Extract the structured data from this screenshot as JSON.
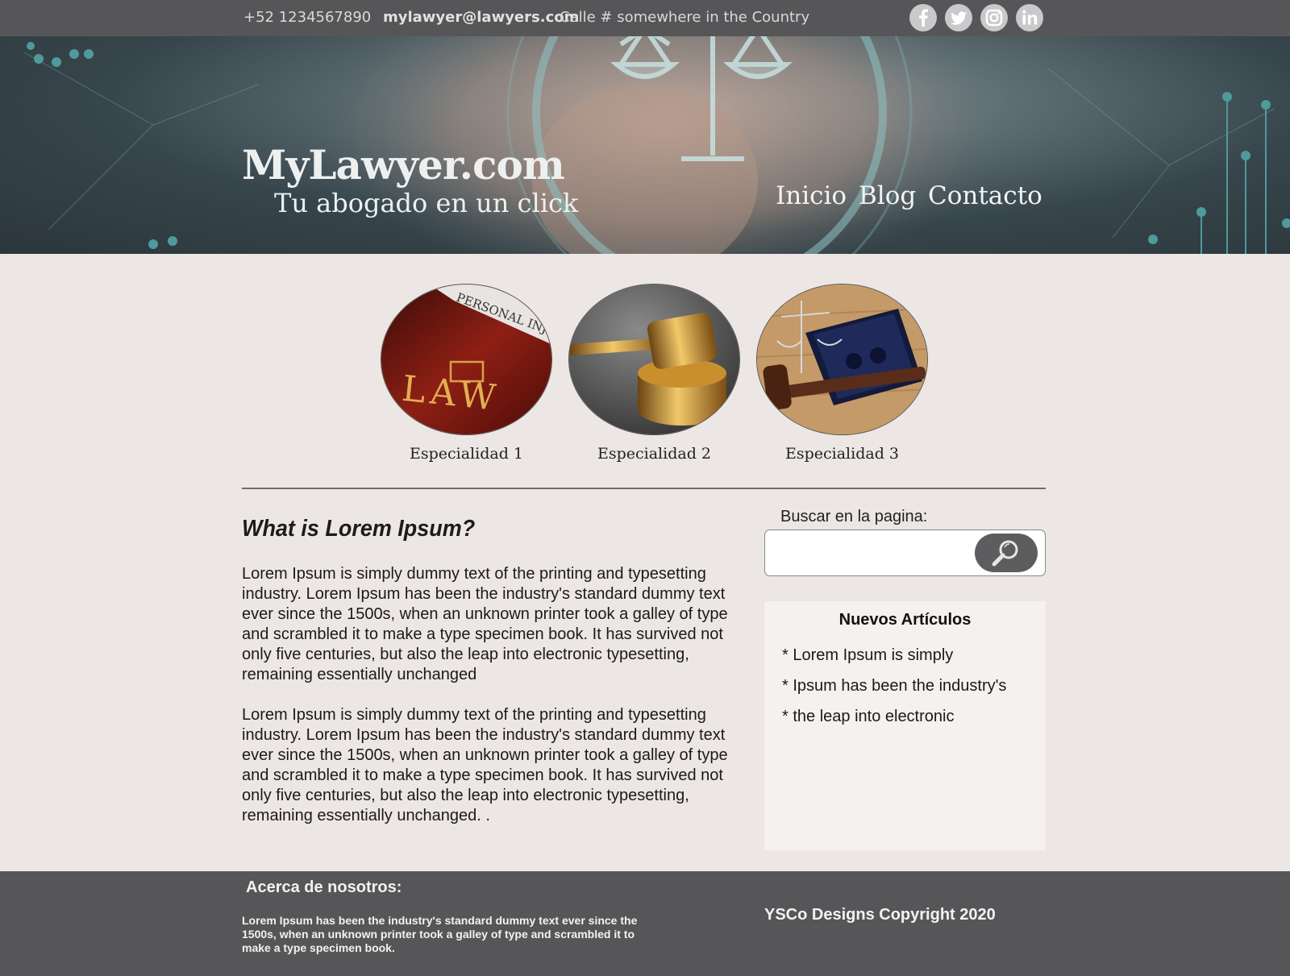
{
  "topbar": {
    "phone": "+52 1234567890",
    "email": "mylawyer@lawyers.com",
    "address": "Calle # somewhere in the Country",
    "social": [
      {
        "icon": "facebook-icon"
      },
      {
        "icon": "twitter-icon"
      },
      {
        "icon": "instagram-icon"
      },
      {
        "icon": "linkedin-icon"
      }
    ]
  },
  "hero": {
    "brand": "MyLawyer.com",
    "tagline": "Tu abogado en un click",
    "nav": [
      "Inicio",
      "Blog",
      "Contacto"
    ]
  },
  "specialties": [
    {
      "label": "Especialidad 1",
      "image": "law-book-image"
    },
    {
      "label": "Especialidad 2",
      "image": "gavel-image"
    },
    {
      "label": "Especialidad 3",
      "image": "scales-and-gavel-image"
    }
  ],
  "article": {
    "title": "What is Lorem Ipsum?",
    "paragraphs": [
      "Lorem Ipsum is simply dummy text of the printing and typesetting industry. Lorem Ipsum has been the industry's standard dummy text ever since the 1500s, when an unknown printer took a galley of type and scrambled it to make a type specimen book. It has survived not only five centuries, but also the leap into electronic typesetting, remaining essentially unchanged",
      "Lorem Ipsum is simply dummy text of the printing and typesetting industry. Lorem Ipsum has been the industry's standard dummy text ever since the 1500s, when an unknown printer took a galley of type and scrambled it to make a type specimen book. It has survived not only five centuries, but also the leap into electronic typesetting, remaining essentially unchanged. ."
    ]
  },
  "search": {
    "label": "Buscar en la pagina:",
    "value": "",
    "icon": "search-icon"
  },
  "news": {
    "title": "Nuevos Artículos",
    "items": [
      "* Lorem Ipsum is simply",
      "*  Ipsum has been the industry's",
      "*  the leap into electronic"
    ]
  },
  "footer": {
    "title": "Acerca de nosotros:",
    "text": "Lorem Ipsum has been the industry's standard dummy text ever since the 1500s, when an unknown printer took a galley of type and scrambled it to make a type specimen book.",
    "copyright": "YSCo Designs Copyright 2020"
  },
  "colors": {
    "topbar": "#565658",
    "page_background": "#ece7e4",
    "news_background": "#f4f1ef",
    "footer": "#565658",
    "accent_teal": "#7fb4b6"
  }
}
